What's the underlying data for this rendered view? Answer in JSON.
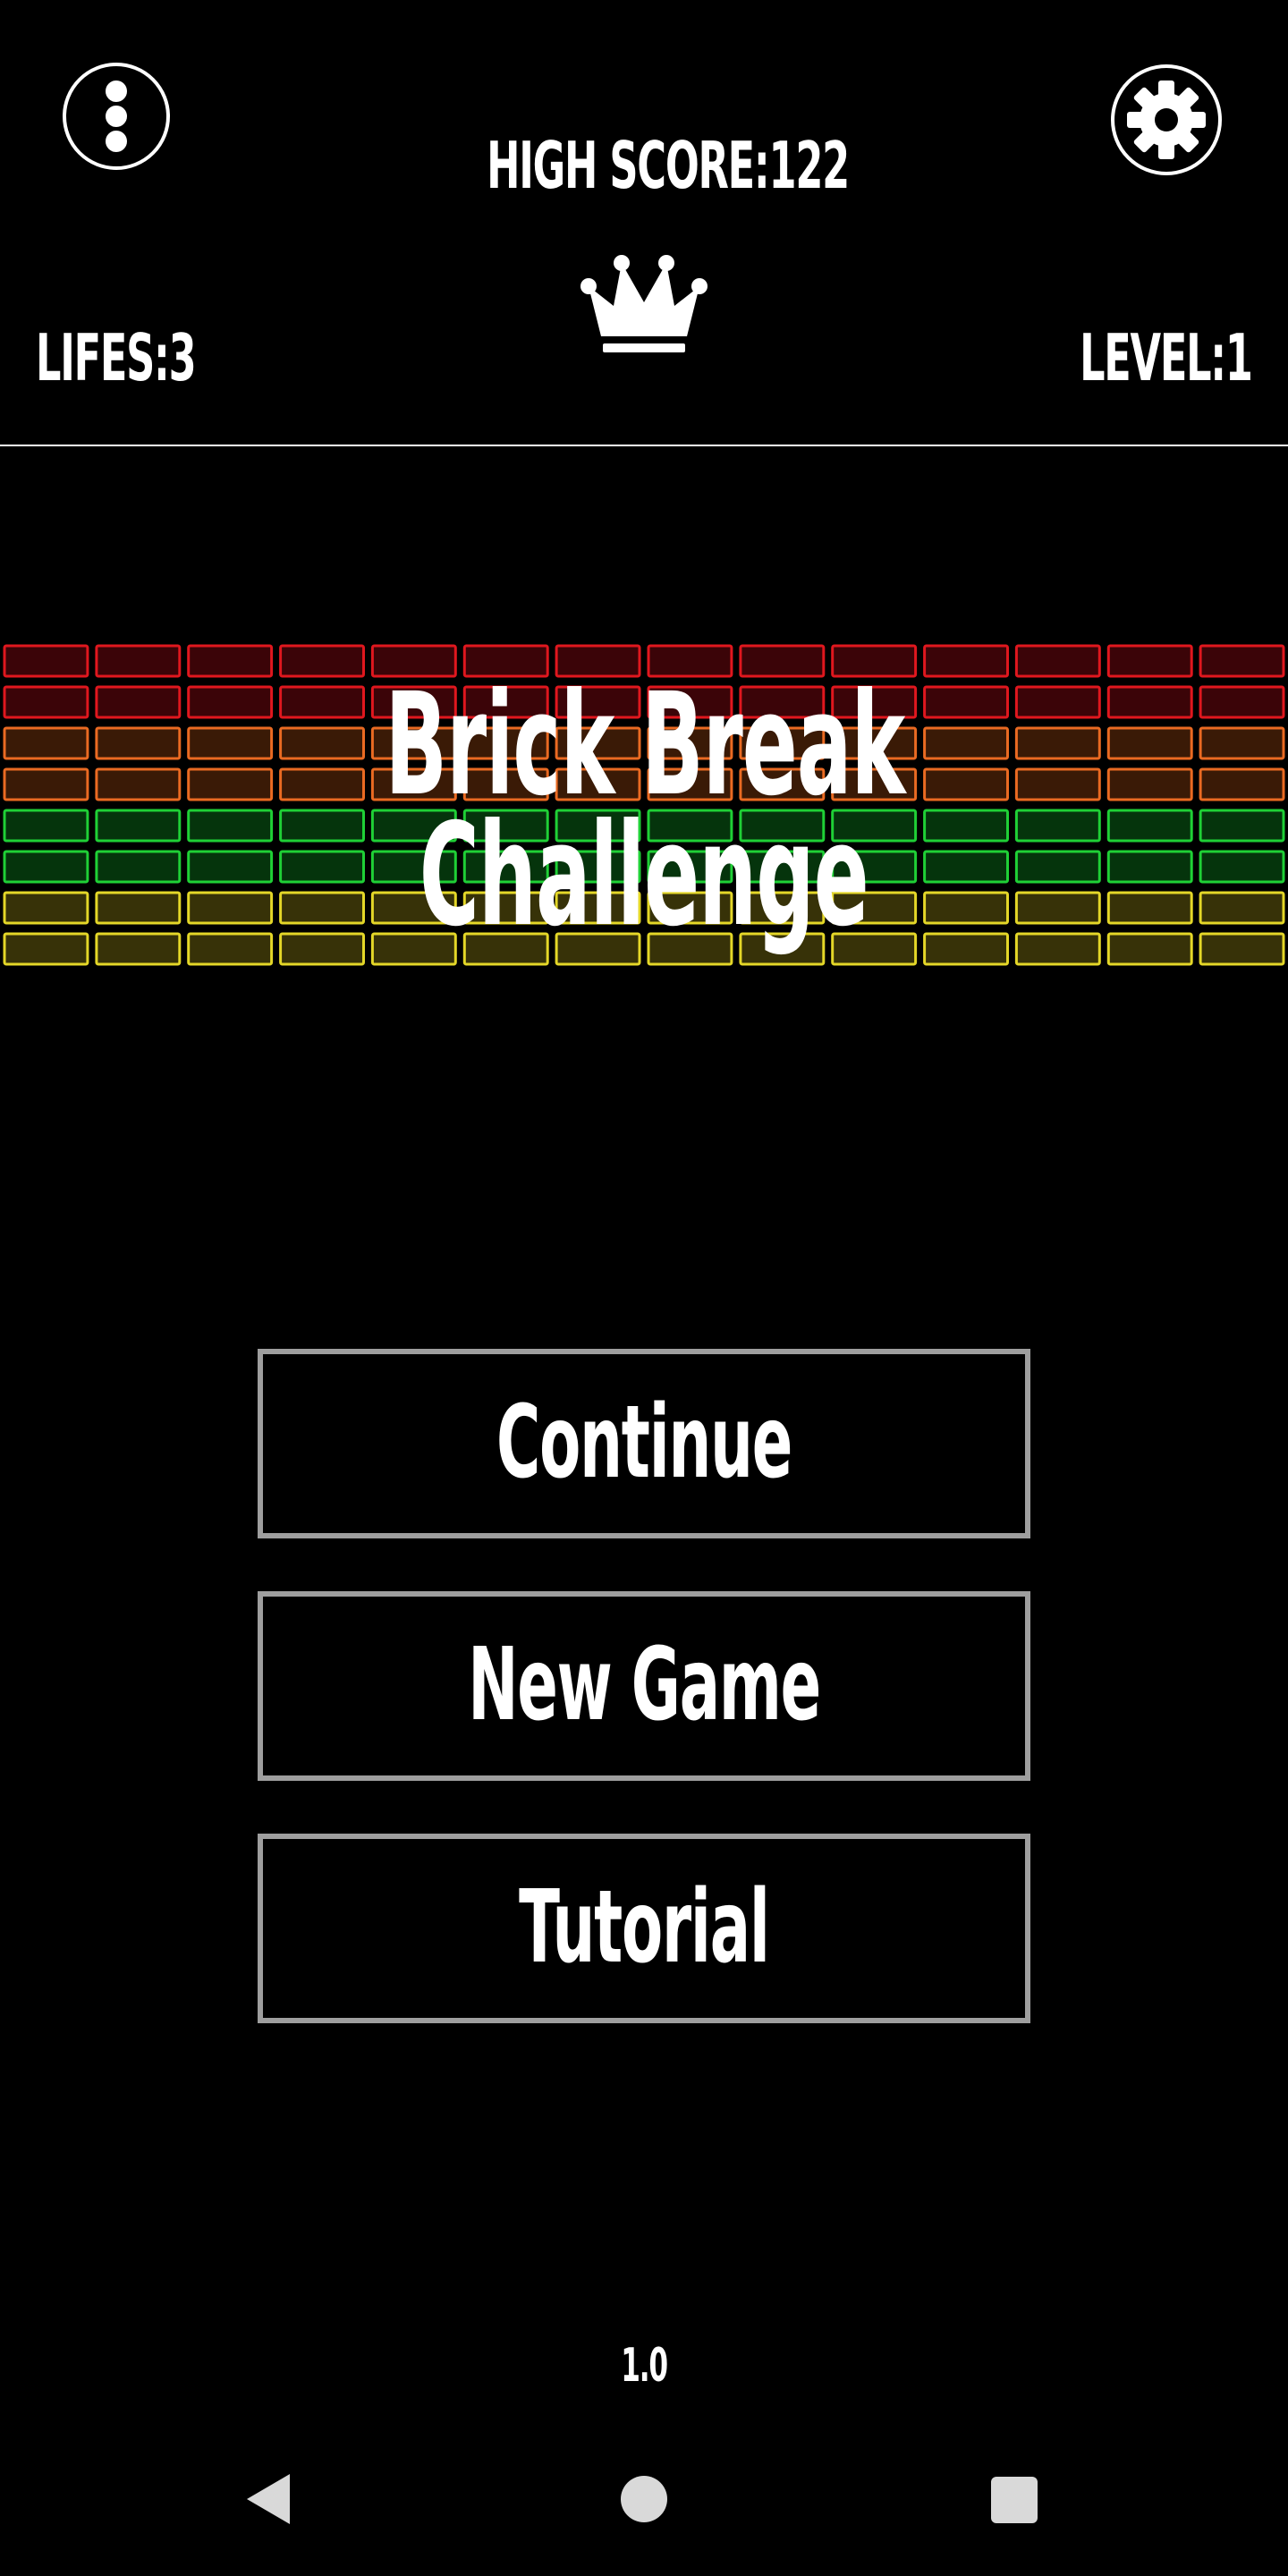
{
  "header": {
    "high_score_text": "HIGH SCORE:122",
    "lifes_text": "LIFES:3",
    "level_text": "LEVEL:1",
    "menu_icon": "more-vertical-icon",
    "settings_icon": "gear-icon",
    "crown_icon": "crown-icon"
  },
  "game": {
    "title_line1": "Brick Break",
    "title_line2": "Challenge",
    "brick_rows": [
      {
        "color": "#e0171e",
        "fill": "#3b0408"
      },
      {
        "color": "#e0171e",
        "fill": "#3b0408"
      },
      {
        "color": "#ea6a22",
        "fill": "#3a1a06"
      },
      {
        "color": "#ea6a22",
        "fill": "#3a1a06"
      },
      {
        "color": "#1fd036",
        "fill": "#05340c"
      },
      {
        "color": "#1fd036",
        "fill": "#05340c"
      },
      {
        "color": "#e4d728",
        "fill": "#373208"
      },
      {
        "color": "#e4d728",
        "fill": "#373208"
      }
    ],
    "bricks_per_row": 14
  },
  "menu": {
    "continue_label": "Continue",
    "new_game_label": "New Game",
    "tutorial_label": "Tutorial"
  },
  "footer": {
    "version": "1.0"
  },
  "navbar": {
    "back_icon": "back-triangle-icon",
    "home_icon": "home-circle-icon",
    "recent_icon": "recent-apps-square-icon"
  },
  "colors": {
    "background": "#000000",
    "text": "#ffffff",
    "button_border": "#9e9e9e"
  }
}
